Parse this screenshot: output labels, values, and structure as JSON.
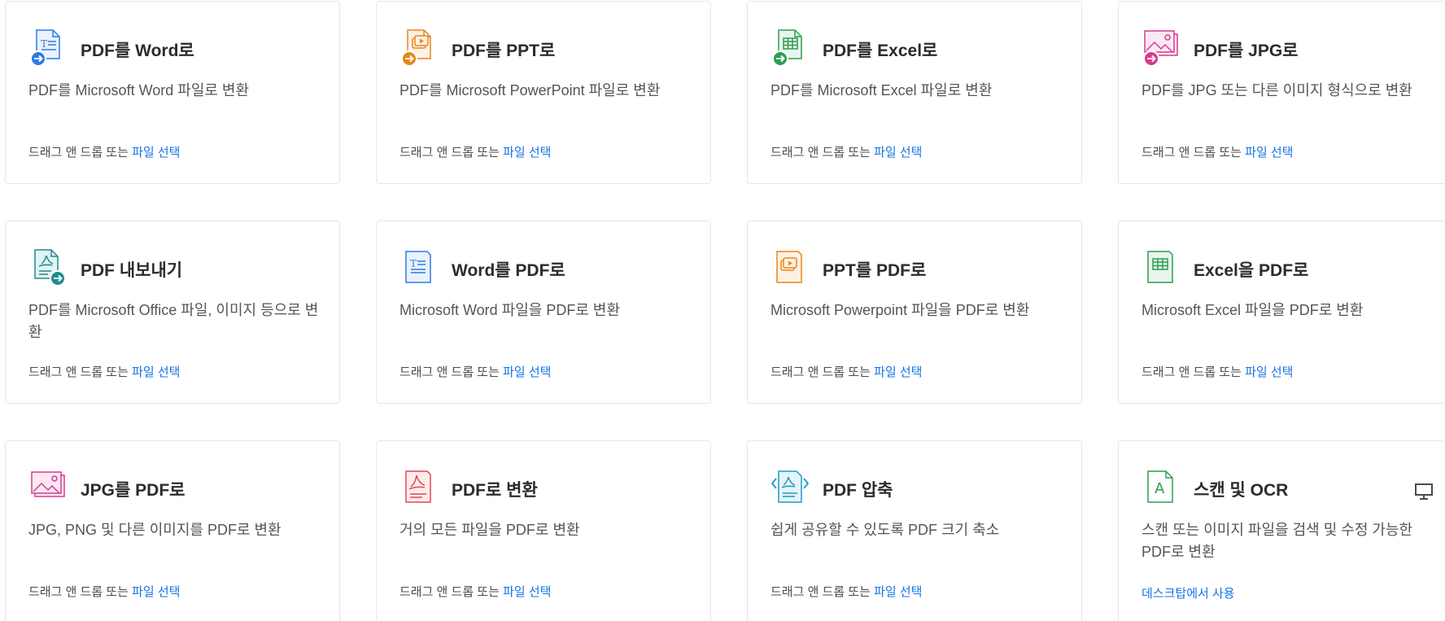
{
  "drag_text": "드래그 앤 드롭 또는 ",
  "select_file": "파일 선택",
  "cards": [
    {
      "title": "PDF를 Word로",
      "desc": "PDF를 Microsoft Word 파일로 변환",
      "icon": "pdf-to-word-icon",
      "color": "#2d7be5"
    },
    {
      "title": "PDF를 PPT로",
      "desc": "PDF를 Microsoft PowerPoint 파일로 변환",
      "icon": "pdf-to-ppt-icon",
      "color": "#e68619"
    },
    {
      "title": "PDF를 Excel로",
      "desc": "PDF를 Microsoft Excel 파일로 변환",
      "icon": "pdf-to-excel-icon",
      "color": "#2d9d52"
    },
    {
      "title": "PDF를 JPG로",
      "desc": "PDF를 JPG 또는 다른 이미지 형식으로 변환",
      "icon": "pdf-to-jpg-icon",
      "color": "#d43b8f"
    },
    {
      "title": "PDF 내보내기",
      "desc": "PDF를 Microsoft Office 파일, 이미지 등으로 변환",
      "icon": "export-pdf-icon",
      "color": "#1f8c8c"
    },
    {
      "title": "Word를 PDF로",
      "desc": "Microsoft Word 파일을 PDF로 변환",
      "icon": "word-to-pdf-icon",
      "color": "#2d7be5"
    },
    {
      "title": "PPT를 PDF로",
      "desc": "Microsoft Powerpoint 파일을 PDF로 변환",
      "icon": "ppt-to-pdf-icon",
      "color": "#e68619"
    },
    {
      "title": "Excel을 PDF로",
      "desc": "Microsoft Excel 파일을 PDF로 변환",
      "icon": "excel-to-pdf-icon",
      "color": "#2d9d52"
    },
    {
      "title": "JPG를 PDF로",
      "desc": "JPG, PNG 및 다른 이미지를 PDF로 변환",
      "icon": "jpg-to-pdf-icon",
      "color": "#d43b8f"
    },
    {
      "title": "PDF로 변환",
      "desc": "거의 모든 파일을 PDF로 변환",
      "icon": "convert-to-pdf-icon",
      "color": "#e34850"
    },
    {
      "title": "PDF 압축",
      "desc": "쉽게 공유할 수 있도록 PDF 크기 축소",
      "icon": "compress-pdf-icon",
      "color": "#1c9bc2"
    },
    {
      "title": "스캔 및 OCR",
      "desc": "스캔 또는 이미지 파일을 검색 및 수정 가능한 PDF로 변환",
      "icon": "scan-ocr-icon",
      "color": "#2d9d52",
      "action": "데스크탑에서 사용"
    }
  ]
}
